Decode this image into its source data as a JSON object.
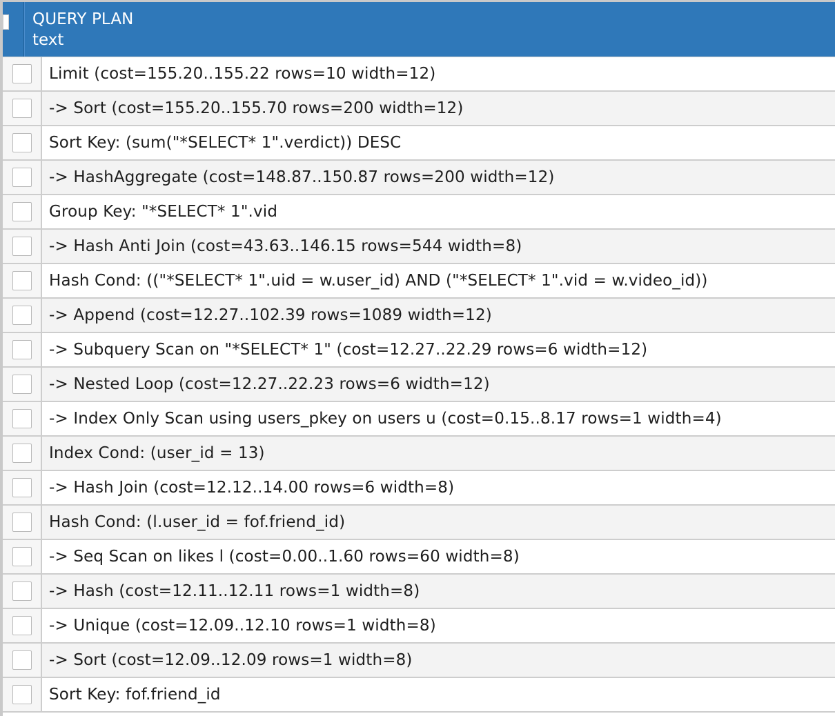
{
  "table": {
    "header": {
      "column_name": "QUERY PLAN",
      "column_type": "text"
    },
    "rows": [
      "Limit (cost=155.20..155.22 rows=10 width=12)",
      "-> Sort (cost=155.20..155.70 rows=200 width=12)",
      "Sort Key: (sum(\"*SELECT* 1\".verdict)) DESC",
      "-> HashAggregate (cost=148.87..150.87 rows=200 width=12)",
      "Group Key: \"*SELECT* 1\".vid",
      "-> Hash Anti Join (cost=43.63..146.15 rows=544 width=8)",
      "Hash Cond: ((\"*SELECT* 1\".uid = w.user_id) AND (\"*SELECT* 1\".vid = w.video_id))",
      "-> Append (cost=12.27..102.39 rows=1089 width=12)",
      "-> Subquery Scan on \"*SELECT* 1\" (cost=12.27..22.29 rows=6 width=12)",
      "-> Nested Loop (cost=12.27..22.23 rows=6 width=12)",
      "-> Index Only Scan using users_pkey on users u (cost=0.15..8.17 rows=1 width=4)",
      "Index Cond: (user_id = 13)",
      "-> Hash Join (cost=12.12..14.00 rows=6 width=8)",
      "Hash Cond: (l.user_id = fof.friend_id)",
      "-> Seq Scan on likes l (cost=0.00..1.60 rows=60 width=8)",
      "-> Hash (cost=12.11..12.11 rows=1 width=8)",
      "-> Unique (cost=12.09..12.10 rows=1 width=8)",
      "-> Sort (cost=12.09..12.09 rows=1 width=8)",
      "Sort Key: fof.friend_id"
    ]
  }
}
